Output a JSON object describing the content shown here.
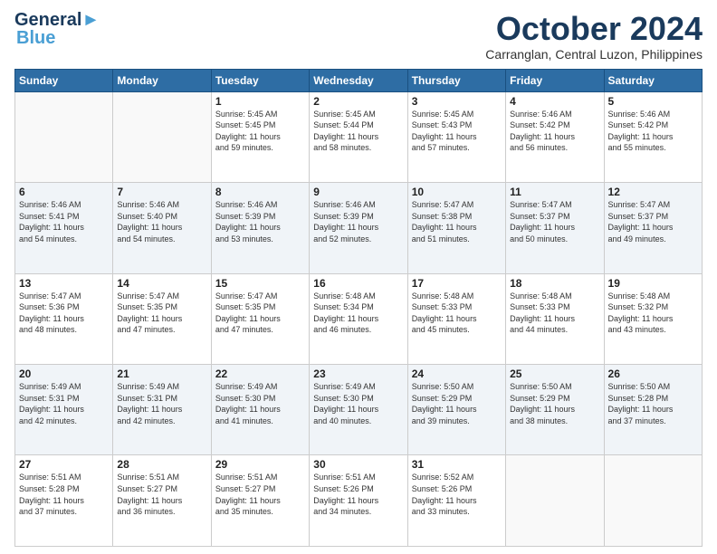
{
  "header": {
    "logo_line1": "General",
    "logo_line2": "Blue",
    "month_year": "October 2024",
    "location": "Carranglan, Central Luzon, Philippines"
  },
  "days_of_week": [
    "Sunday",
    "Monday",
    "Tuesday",
    "Wednesday",
    "Thursday",
    "Friday",
    "Saturday"
  ],
  "weeks": [
    [
      {
        "day": "",
        "detail": ""
      },
      {
        "day": "",
        "detail": ""
      },
      {
        "day": "1",
        "detail": "Sunrise: 5:45 AM\nSunset: 5:45 PM\nDaylight: 11 hours\nand 59 minutes."
      },
      {
        "day": "2",
        "detail": "Sunrise: 5:45 AM\nSunset: 5:44 PM\nDaylight: 11 hours\nand 58 minutes."
      },
      {
        "day": "3",
        "detail": "Sunrise: 5:45 AM\nSunset: 5:43 PM\nDaylight: 11 hours\nand 57 minutes."
      },
      {
        "day": "4",
        "detail": "Sunrise: 5:46 AM\nSunset: 5:42 PM\nDaylight: 11 hours\nand 56 minutes."
      },
      {
        "day": "5",
        "detail": "Sunrise: 5:46 AM\nSunset: 5:42 PM\nDaylight: 11 hours\nand 55 minutes."
      }
    ],
    [
      {
        "day": "6",
        "detail": "Sunrise: 5:46 AM\nSunset: 5:41 PM\nDaylight: 11 hours\nand 54 minutes."
      },
      {
        "day": "7",
        "detail": "Sunrise: 5:46 AM\nSunset: 5:40 PM\nDaylight: 11 hours\nand 54 minutes."
      },
      {
        "day": "8",
        "detail": "Sunrise: 5:46 AM\nSunset: 5:39 PM\nDaylight: 11 hours\nand 53 minutes."
      },
      {
        "day": "9",
        "detail": "Sunrise: 5:46 AM\nSunset: 5:39 PM\nDaylight: 11 hours\nand 52 minutes."
      },
      {
        "day": "10",
        "detail": "Sunrise: 5:47 AM\nSunset: 5:38 PM\nDaylight: 11 hours\nand 51 minutes."
      },
      {
        "day": "11",
        "detail": "Sunrise: 5:47 AM\nSunset: 5:37 PM\nDaylight: 11 hours\nand 50 minutes."
      },
      {
        "day": "12",
        "detail": "Sunrise: 5:47 AM\nSunset: 5:37 PM\nDaylight: 11 hours\nand 49 minutes."
      }
    ],
    [
      {
        "day": "13",
        "detail": "Sunrise: 5:47 AM\nSunset: 5:36 PM\nDaylight: 11 hours\nand 48 minutes."
      },
      {
        "day": "14",
        "detail": "Sunrise: 5:47 AM\nSunset: 5:35 PM\nDaylight: 11 hours\nand 47 minutes."
      },
      {
        "day": "15",
        "detail": "Sunrise: 5:47 AM\nSunset: 5:35 PM\nDaylight: 11 hours\nand 47 minutes."
      },
      {
        "day": "16",
        "detail": "Sunrise: 5:48 AM\nSunset: 5:34 PM\nDaylight: 11 hours\nand 46 minutes."
      },
      {
        "day": "17",
        "detail": "Sunrise: 5:48 AM\nSunset: 5:33 PM\nDaylight: 11 hours\nand 45 minutes."
      },
      {
        "day": "18",
        "detail": "Sunrise: 5:48 AM\nSunset: 5:33 PM\nDaylight: 11 hours\nand 44 minutes."
      },
      {
        "day": "19",
        "detail": "Sunrise: 5:48 AM\nSunset: 5:32 PM\nDaylight: 11 hours\nand 43 minutes."
      }
    ],
    [
      {
        "day": "20",
        "detail": "Sunrise: 5:49 AM\nSunset: 5:31 PM\nDaylight: 11 hours\nand 42 minutes."
      },
      {
        "day": "21",
        "detail": "Sunrise: 5:49 AM\nSunset: 5:31 PM\nDaylight: 11 hours\nand 42 minutes."
      },
      {
        "day": "22",
        "detail": "Sunrise: 5:49 AM\nSunset: 5:30 PM\nDaylight: 11 hours\nand 41 minutes."
      },
      {
        "day": "23",
        "detail": "Sunrise: 5:49 AM\nSunset: 5:30 PM\nDaylight: 11 hours\nand 40 minutes."
      },
      {
        "day": "24",
        "detail": "Sunrise: 5:50 AM\nSunset: 5:29 PM\nDaylight: 11 hours\nand 39 minutes."
      },
      {
        "day": "25",
        "detail": "Sunrise: 5:50 AM\nSunset: 5:29 PM\nDaylight: 11 hours\nand 38 minutes."
      },
      {
        "day": "26",
        "detail": "Sunrise: 5:50 AM\nSunset: 5:28 PM\nDaylight: 11 hours\nand 37 minutes."
      }
    ],
    [
      {
        "day": "27",
        "detail": "Sunrise: 5:51 AM\nSunset: 5:28 PM\nDaylight: 11 hours\nand 37 minutes."
      },
      {
        "day": "28",
        "detail": "Sunrise: 5:51 AM\nSunset: 5:27 PM\nDaylight: 11 hours\nand 36 minutes."
      },
      {
        "day": "29",
        "detail": "Sunrise: 5:51 AM\nSunset: 5:27 PM\nDaylight: 11 hours\nand 35 minutes."
      },
      {
        "day": "30",
        "detail": "Sunrise: 5:51 AM\nSunset: 5:26 PM\nDaylight: 11 hours\nand 34 minutes."
      },
      {
        "day": "31",
        "detail": "Sunrise: 5:52 AM\nSunset: 5:26 PM\nDaylight: 11 hours\nand 33 minutes."
      },
      {
        "day": "",
        "detail": ""
      },
      {
        "day": "",
        "detail": ""
      }
    ]
  ]
}
